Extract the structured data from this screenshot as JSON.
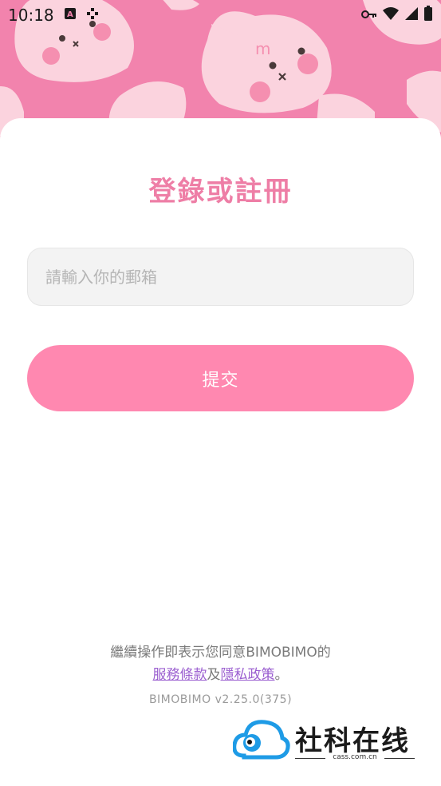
{
  "status_bar": {
    "time": "10:18",
    "icons_left": [
      "a-notification-icon",
      "app-notification-icon"
    ],
    "icons_right": [
      "vpn-key-icon",
      "wifi-icon",
      "signal-icon",
      "battery-icon"
    ]
  },
  "login": {
    "title": "登錄或註冊",
    "email_placeholder": "請輸入你的郵箱",
    "email_value": "",
    "submit_label": "提交"
  },
  "terms": {
    "prefix": "繼續操作即表示您同意BIMOBIMO的",
    "service_link": "服務條款",
    "connector": "及",
    "privacy_link": "隱私政策",
    "suffix": "。"
  },
  "version": "BIMOBIMO v2.25.0(375)",
  "watermark": {
    "title": "社科在线",
    "domain": "cass.com.cn"
  },
  "colors": {
    "header_pink": "#f283ad",
    "title_pink": "#ee7ea6",
    "button_pink": "#ff88b0",
    "link_purple": "#9b5fd0"
  }
}
